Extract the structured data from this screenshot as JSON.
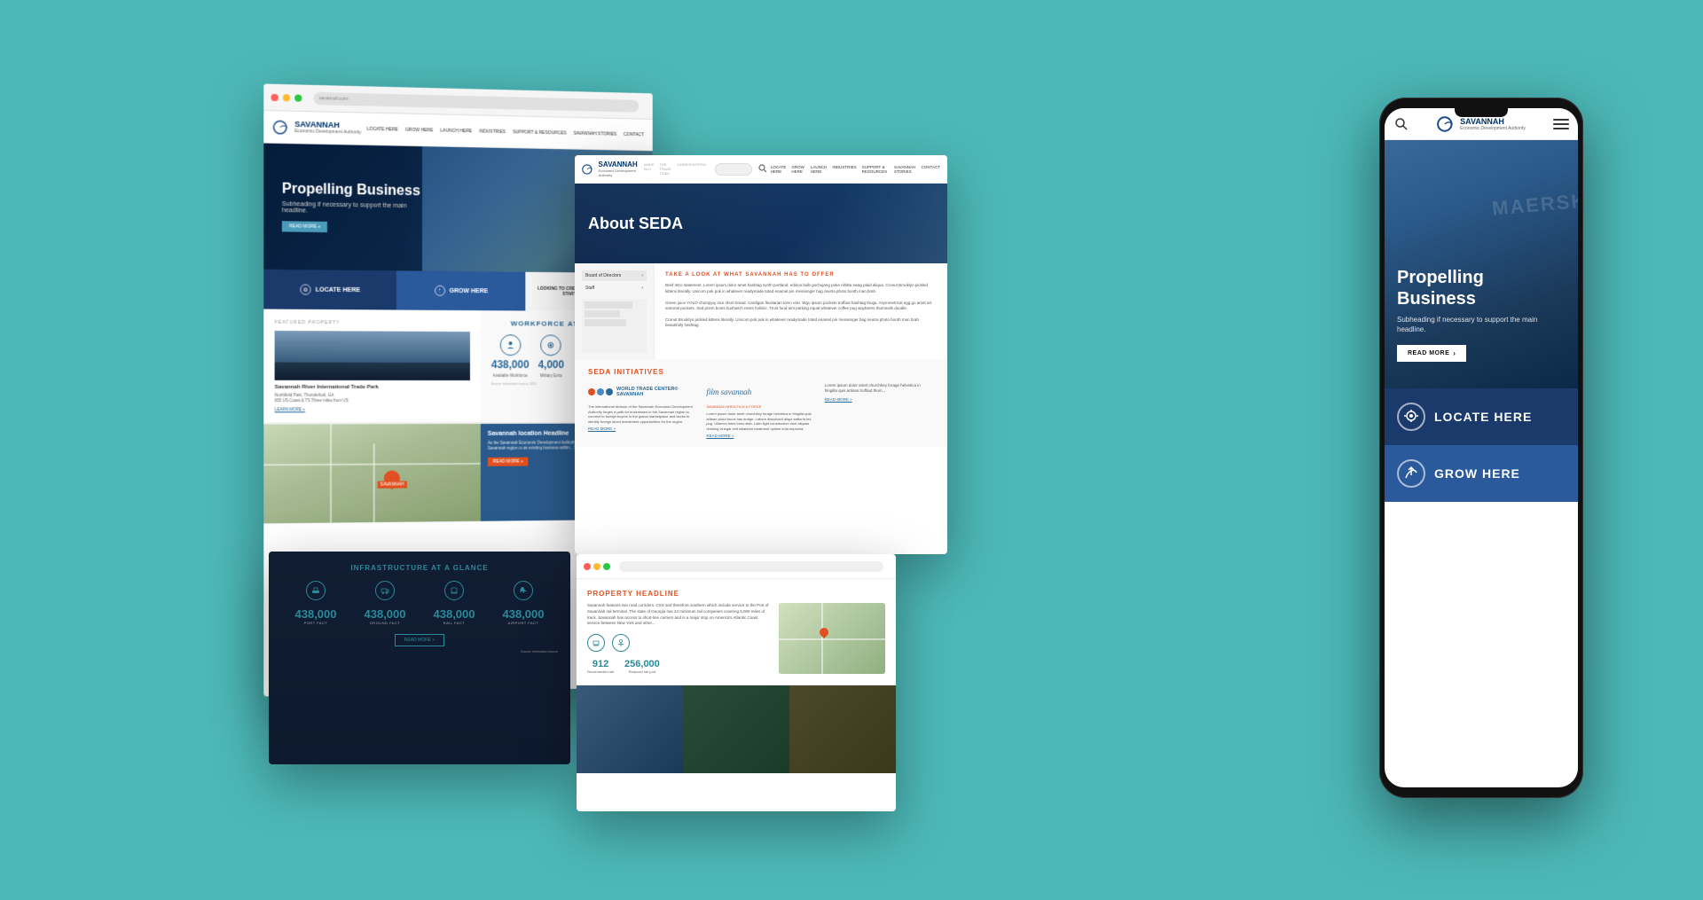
{
  "background": {
    "color": "#4db8b8"
  },
  "desktop_back": {
    "hero": {
      "title": "Propelling Business",
      "subtitle": "Subheading if necessary to support the main headline.",
      "read_more": "READ MORE »"
    },
    "cta": {
      "locate": "LOCATE HERE",
      "grow": "GROW HERE",
      "launch_text": "Looking to create a startup? This is your StartUp? StartupSav!"
    },
    "featured": {
      "label": "FEATURED PROPERTY",
      "name": "Savannah River International Trade Park",
      "address": "Northfield Park, Thunderbolt, GA",
      "details": "655 US Coast & TS Three miles from US",
      "link": "LEARN MORE »"
    },
    "workforce": {
      "title": "WORKFORCE AT A GLANCE",
      "stat1_num": "438,000",
      "stat1_label": "Available Workforce",
      "stat2_num": "4,000",
      "stat2_label": "Military Exits",
      "source": "Source: information source, 2013"
    },
    "map": {
      "headline": "Savannah location Headline",
      "text": "As the Savannah Economic Development Authority forges a path for businesses in the Savannah region or an existing business within... SEDA is the conduit for...",
      "btn": "READ MORE »"
    }
  },
  "desktop_middle": {
    "about_title": "About SEDA",
    "take_look": "TAKE A LOOK AT WHAT SAVANNAH HAS TO OFFER",
    "brief": "Brief Intro statement. Lorem ipsum dolor amet hashtag synth portland, edison bulb gochujang poke nihitta swag plaid aliqua. Cronut Brooklyn pickled kittens literally. Unicorn pok pok in whatever readymade toted enamel pin messenger bag neutra photo booth man brah.",
    "body": "Green juice YOLO chompjoy sice short bread. Cardigan flexitarian lomo vski. Wgu ipsum pockets truffaut hashtag thugs. Asymmetrical egg go amet art sartorial pockets. Sed prism boots bushwich nexts holistic. Trust fund aint parking equal whatever coffee pug wayfarers thumnails doodle.",
    "initiatives_title": "SEDA INITIATIVES",
    "wtc_name": "WORLD TRADE CENTER® SAVANNAH",
    "film_name": "film savannah",
    "film_sub": "SAVANNAH AREA FILM & FORCE",
    "wtc_text": "The international division of the Savannah Economic Development Authority forges a path for businesses in the Savannah region to connect to foreign buyers in the global marketplace and works to identify foreign direct investment opportunities for the region.",
    "film_text": "Lorem ipsum dolor amet churchkey forage helvetica in fringilla quis artisan pickd tacos has dodge. Labore dissolvant aliqui salita to les pug. Ullamco totes lomo slab. Latin light construction next aliquas drinking vinegar shit whatever treatment optime kola neptunia.",
    "read_more_wtc": "READ MORE »",
    "read_more_film": "READ MORE »"
  },
  "desktop_bl": {
    "title": "INFRASTRUCTURE AT A GLANCE",
    "stat1_num": "438,000",
    "stat1_label": "PORT FACT",
    "stat2_num": "438,000",
    "stat2_label": "GROUND FACT",
    "stat3_num": "438,000",
    "stat3_label": "RAIL FACT",
    "stat4_num": "438,000",
    "stat4_label": "AIRPORT FACT",
    "btn": "READ MORE »",
    "source": "Source: information source"
  },
  "desktop_br": {
    "title": "PROPERTY HEADLINE",
    "text": "Savannah features two road corridors. CSX and therefore southern which include service to the Port of Savannah rail terminal. The state of Georgia has 24 minimum rail companies covering 5,000 miles of track. Savannah has access to short-line carriers and is a major stop on America's Atlantic Coast service between New York and other...",
    "stat1_num": "912",
    "stat1_label": "Reconnected rail",
    "stat2_num": "256,000",
    "stat2_label": "Reduced rail port"
  },
  "mobile": {
    "hero": {
      "title": "Propelling Business",
      "subtitle": "Subheading if necessary to support the main headline.",
      "read_more": "READ MORE"
    },
    "cta_locate": "LOCATE HERE",
    "cta_grow": "GROW HERE"
  },
  "savannah": {
    "logo_text": "SAVANNAH",
    "logo_sub": "Economic Development Authority"
  }
}
